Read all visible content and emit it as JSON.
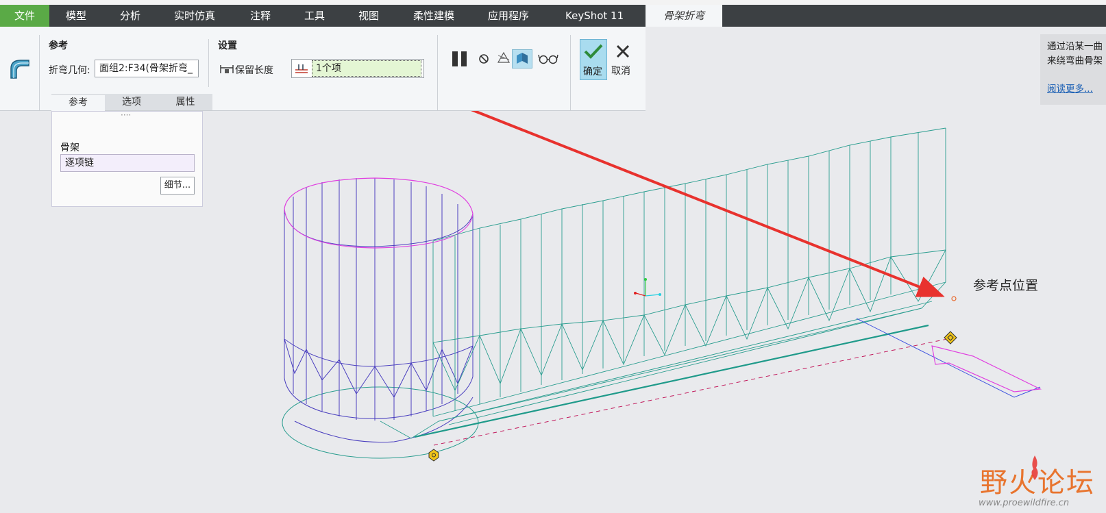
{
  "menu": {
    "items": [
      "文件",
      "模型",
      "分析",
      "实时仿真",
      "注释",
      "工具",
      "视图",
      "柔性建模",
      "应用程序",
      "KeyShot 11"
    ],
    "active_tab": "骨架折弯"
  },
  "ribbon": {
    "reference_group": "参考",
    "bend_geometry_label": "折弯几何:",
    "bend_geometry_value": "面组2:F34(骨架折弯_",
    "settings_group": "设置",
    "preserve_length_label": "保留长度",
    "item_field_value": "1个项",
    "confirm_label": "确定",
    "cancel_label": "取消"
  },
  "tabs": [
    "参考",
    "选项",
    "属性"
  ],
  "ref_panel": {
    "dots": "····",
    "skeleton_label": "骨架",
    "skeleton_value": "逐项链",
    "details_button": "细节..."
  },
  "info_panel": {
    "line1": "通过沿某一曲",
    "line2": "来绕弯曲骨架",
    "link": "阅读更多..."
  },
  "annotation": "参考点位置",
  "watermark": {
    "text": "野火论坛",
    "url": "www.proewildfire.cn"
  },
  "colors": {
    "menu_bg": "#3c4043",
    "file_tab": "#5aaa46",
    "active_field": "#e4f6d4",
    "confirm_bg": "#a9dcef",
    "arrow": "#e8322e",
    "mesh_teal": "#2a9d8f",
    "mesh_purple": "#4a3fbf",
    "pink_edge": "#e040e0"
  }
}
